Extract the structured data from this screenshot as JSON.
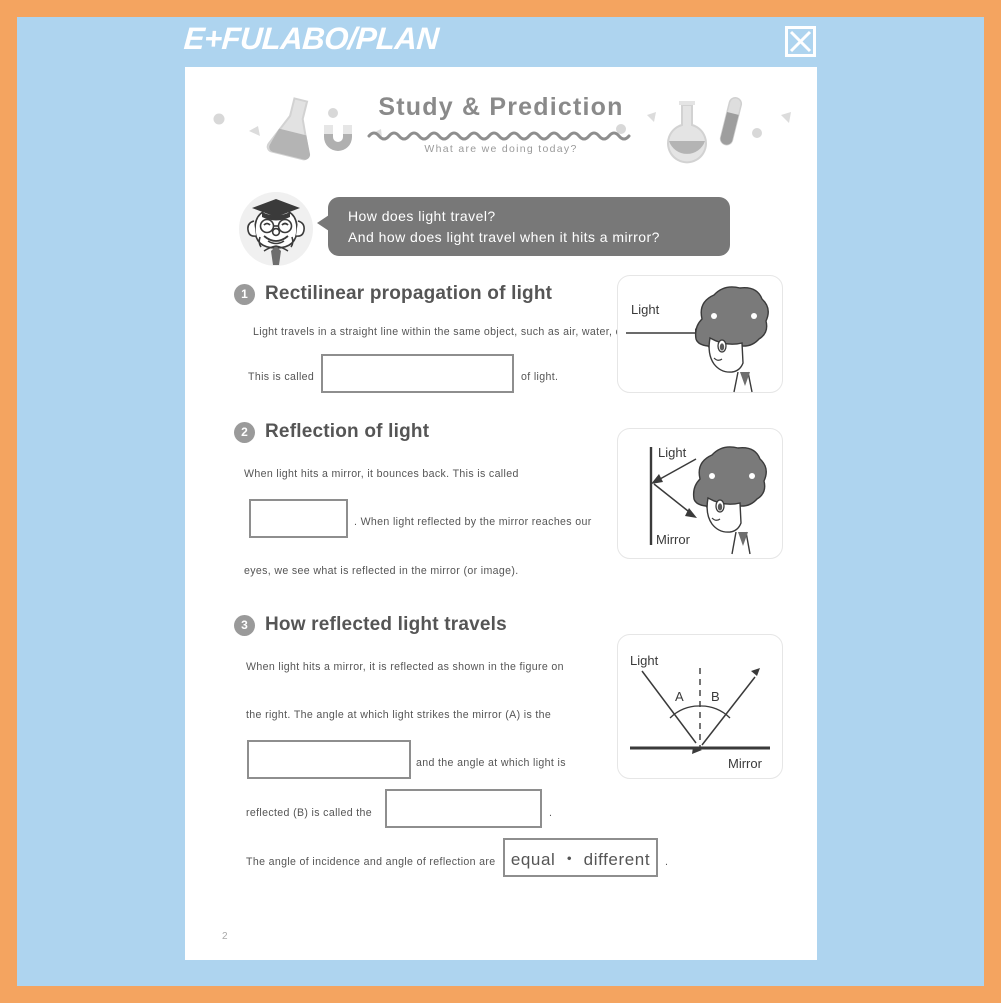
{
  "window": {
    "app_title": "E+FULABO/PLAN",
    "close_icon": "close-x-icon",
    "frame_color": "#f4a460",
    "chrome_color": "#aed4ef"
  },
  "worksheet": {
    "title": "Study & Prediction",
    "subtitle": "What are we doing today?",
    "page_number": "2",
    "decor_icons": [
      "erlenmeyer-flask-icon",
      "magnet-icon",
      "round-flask-icon",
      "test-tube-icon"
    ],
    "intro": {
      "avatar_icon": "professor-avatar-icon",
      "bubble_lines": [
        "How does light travel?",
        "And how does light travel when it hits a mirror?"
      ]
    },
    "sections": [
      {
        "number": "1",
        "title": "Rectilinear propagation of light",
        "lead": "Light travels in a straight line within the same object, such as air, water, or glass.",
        "fill_before": "This is called",
        "blank_value": "",
        "fill_after": "of light.",
        "figure": {
          "name": "light-hits-face-figure",
          "light_label": "Light",
          "mirror_label": "",
          "face_icon": "child-face-profile-icon"
        }
      },
      {
        "number": "2",
        "title": "Reflection of light",
        "line1": "When light hits a mirror, it bounces back. This is called",
        "blank_value": "",
        "line2": ". When light reflected by the mirror reaches our",
        "line3": "eyes, we see what is reflected in the mirror (or image).",
        "figure": {
          "name": "mirror-reflection-figure",
          "light_label": "Light",
          "mirror_label": "Mirror",
          "face_icon": "child-face-profile-icon"
        }
      },
      {
        "number": "3",
        "title": "How reflected light travels",
        "line1": "When light hits a mirror, it is reflected as shown in the figure on",
        "line2": "the right. The angle at which light strikes the mirror (A) is the",
        "blank1_value": "",
        "line3": "and the angle at which light is",
        "line4": "reflected (B) is called the",
        "blank2_value": "",
        "line5": ".",
        "line6": "The angle of incidence and angle of reflection are",
        "choice_text": "equal ・ different",
        "line7": ".",
        "figure": {
          "name": "angle-of-reflection-figure",
          "light_label": "Light",
          "mirror_label": "Mirror",
          "angle_a_label": "A",
          "angle_b_label": "B"
        }
      }
    ]
  }
}
